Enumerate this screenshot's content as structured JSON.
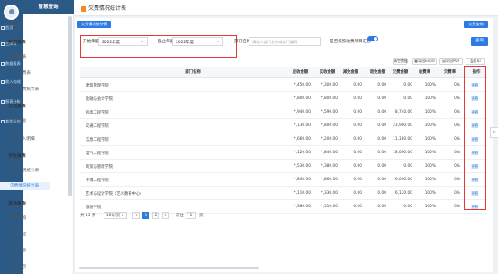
{
  "app": {
    "brand": "智慧查询",
    "page_title": "欠费情况统计表"
  },
  "rail": [
    {
      "label": "首页"
    },
    {
      "label": "三库表"
    },
    {
      "label": "数据报表"
    },
    {
      "label": "收入构成"
    },
    {
      "label": "报表分析"
    },
    {
      "label": "其他系统"
    }
  ],
  "menu": {
    "home": "首页",
    "groups": [
      {
        "title": "数据报表",
        "items": [
          "收费报表",
          "个人收费表",
          "个人缴费统计表"
        ]
      },
      {
        "title": "工资报表",
        "items": [
          "工资汇总",
          "其他收入明细"
        ]
      },
      {
        "title": "学生报表",
        "items": [
          "收费情况统计表",
          "欠费情况统计表"
        ]
      },
      {
        "title": "其他查询",
        "items": [
          "就诊查询",
          "就诊认证",
          "认同信息",
          "来访提示"
        ]
      }
    ],
    "active": "欠费情况统计表"
  },
  "crumbs": {
    "left": "欠费情况统计表",
    "right": "欠费查询"
  },
  "filters": {
    "start_label": "开始年度",
    "start_value": "2022年度",
    "end_label": "截止年度",
    "end_value": "2022年度",
    "dept_label": "部门名称",
    "dept_placeholder": "请输入部门名称或部门编码",
    "toggle_label": "是否按照收费项目汇总",
    "query_button": "查询"
  },
  "toolbar": {
    "reset": "清空数据",
    "export_excel": "导出Excel",
    "export_pdf": "导出PDF",
    "print": "打印"
  },
  "table": {
    "headers": [
      "部门名称",
      "应收金额",
      "实收金额",
      "减免金额",
      "退免金额",
      "欠费金额",
      "收费率",
      "欠费率",
      "操作"
    ],
    "rows": [
      {
        "dept": "建筑管理学院",
        "due": "*,450.00",
        "paid": "*,300.00",
        "reduce": "0.00",
        "refund": "0.00",
        "arrears": "0.00",
        "rate": "100%",
        "arrears_rate": "0%",
        "op": "查看"
      },
      {
        "dept": "金融与会计学院",
        "due": "*,800.00",
        "paid": "*,800.00",
        "reduce": "0.00",
        "refund": "0.00",
        "arrears": "0.00",
        "rate": "100%",
        "arrears_rate": "0%",
        "op": "查看"
      },
      {
        "dept": "机电工程学院",
        "due": "*,940.00",
        "paid": "*,590.00",
        "reduce": "0.00",
        "refund": "0.00",
        "arrears": "8,740.00",
        "rate": "100%",
        "arrears_rate": "0%",
        "op": "查看"
      },
      {
        "dept": "交通工程学院",
        "due": "*,130.00",
        "paid": "*,800.00",
        "reduce": "0.00",
        "refund": "0.00",
        "arrears": "23,900.00",
        "rate": "100%",
        "arrears_rate": "0%",
        "op": "查看"
      },
      {
        "dept": "信息工程学院",
        "due": "*,660.00",
        "paid": "*,200.00",
        "reduce": "0.00",
        "refund": "0.00",
        "arrears": "11,180.00",
        "rate": "100%",
        "arrears_rate": "0%",
        "op": "查看"
      },
      {
        "dept": "电气工程学院",
        "due": "*,120.00",
        "paid": "*,840.00",
        "reduce": "0.00",
        "refund": "0.00",
        "arrears": "18,000.00",
        "rate": "100%",
        "arrears_rate": "0%",
        "op": "查看"
      },
      {
        "dept": "商贸与管理学院",
        "due": "*,530.00",
        "paid": "*,380.00",
        "reduce": "0.00",
        "refund": "0.00",
        "arrears": "0.00",
        "rate": "100%",
        "arrears_rate": "0%",
        "op": "查看"
      },
      {
        "dept": "环境工程学院",
        "due": "*,840.00",
        "paid": "*,860.00",
        "reduce": "0.00",
        "refund": "0.00",
        "arrears": "6,000.00",
        "rate": "100%",
        "arrears_rate": "0%",
        "op": "查看"
      },
      {
        "dept": "艺术与设计学院（艺术教育中心）",
        "due": "*,110.00",
        "paid": "*,330.00",
        "reduce": "0.00",
        "refund": "0.00",
        "arrears": "6,120.00",
        "rate": "100%",
        "arrears_rate": "0%",
        "op": "查看"
      },
      {
        "dept": "旅游学院",
        "due": "*,380.00",
        "paid": "*,510.00",
        "reduce": "0.00",
        "refund": "0.00",
        "arrears": "0.00",
        "rate": "100%",
        "arrears_rate": "0%",
        "op": "查看"
      }
    ]
  },
  "pager": {
    "total": "共 13 条",
    "size": "10条/页",
    "pages": [
      "1",
      "2"
    ],
    "next": ">",
    "prev": "<",
    "goto": "前往",
    "goto_value": "1",
    "page_unit": "页"
  }
}
